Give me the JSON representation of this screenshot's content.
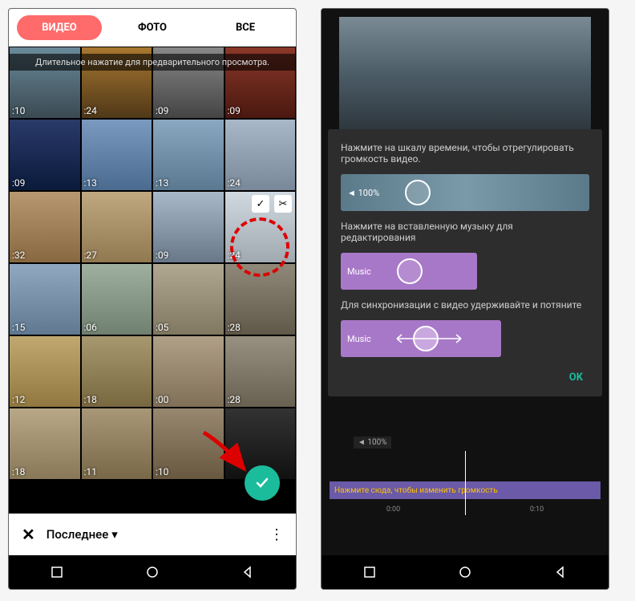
{
  "left": {
    "tabs": {
      "video": "ВИДЕО",
      "photo": "ФОТО",
      "all": "ВСЕ"
    },
    "hint": "Длительное нажатие для предварительного просмотра.",
    "durations": [
      ":10",
      ":24",
      ":09",
      ":09",
      ":09",
      ":13",
      ":13",
      ":24",
      ":32",
      ":27",
      ":09",
      ":24",
      ":15",
      ":06",
      ":05",
      ":28",
      ":12",
      ":18",
      ":00",
      ":28",
      ":18",
      ":11",
      ":10",
      ""
    ],
    "bottom": {
      "dropdown": "Последнее"
    },
    "icons": {
      "check": "✓",
      "scissors": "✂"
    }
  },
  "right": {
    "dialog": {
      "tip1": "Нажмите на шкалу времени, чтобы отрегулировать громкость видео.",
      "video_vol": "100%",
      "tip2": "Нажмите на вставленную музыку для редактирования",
      "music1": "Music",
      "tip3": "Для синхронизации с видео удерживайте и потяните",
      "music2": "Music",
      "ok": "OK"
    },
    "timeline": {
      "vol_badge": "◄ 100%",
      "bar_text": "Нажмите сюда, чтобы изменить громкость",
      "times": [
        "0:00",
        "0:10"
      ]
    }
  }
}
